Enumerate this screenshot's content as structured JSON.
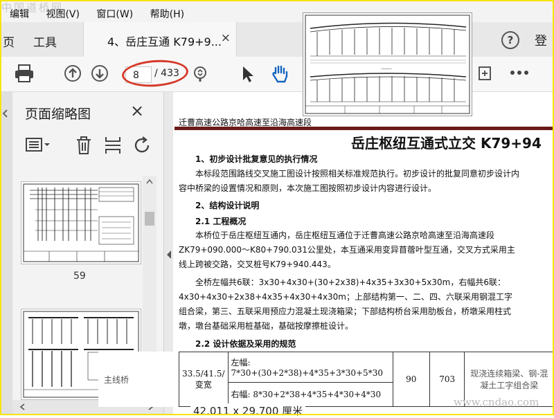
{
  "watermark_top": "中国道桥网",
  "menu": [
    "编辑",
    "视图(V)",
    "窗口(W)",
    "帮助(H)"
  ],
  "tabs": {
    "left_partial": "页",
    "tools": "工具",
    "document": "4、岳庄互通 K79+9...",
    "close": "×",
    "login_partial": "登"
  },
  "toolbar": {
    "page_current": "8",
    "page_total": "/ 433"
  },
  "sidebar": {
    "title": "页面缩略图",
    "close": "×",
    "thumb_page": "59"
  },
  "document": {
    "header": "迁曹高速公路京哈高速至沿海高速段",
    "title": "岳庄枢纽互通式立交 K79+94",
    "sec1": "1、初步设计批复意见的执行情况",
    "p1": "本标段范围路线交叉施工图设计按照相关标准规范执行。初步设计的批复同意初步设计内容中桥梁的设置情况和原则，本次施工图按照初步设计内容进行设计。",
    "sec2": "2、结构设计说明",
    "sec21": "2.1 工程概况",
    "p2": "本桥位于岳庄枢纽互通内，岳庄枢纽互通位于迁曹高速公路京哈高速至沿海高速段ZK79+090.000～K80+790.031公里处，本互通采用变异苜蓿叶型互通，交叉方式采用主线上跨被交路，交叉桩号K79+940.443。",
    "p3": "全桥左幅共6联：3x30+4x30+(30+2x38)+4x35+3x30+5x30m，右幅共6联：",
    "p4": "4x30+4x30+2x38+4x35+4x30+4x30m；上部结构第一、二、四、六联采用钢混工字组合梁，第三、五联采用预应力混凝土现浇箱梁；下部结构桥台采用肋板台，桥墩采用柱式墩，墩台基础采用桩基础，基础按摩擦桩设计。",
    "sec22": "2.2 设计依据及采用的规范",
    "table": {
      "c_width": "33.5/41.5/变宽",
      "left_label": "左幅:",
      "left_span": "7*30+(30+2*38)+4*35+3*30+5*30",
      "right_span": "右幅: 8*30+2*38+4*35+4*30+4*30",
      "col3": "90",
      "col4": "703",
      "col5": "现浇连续箱梁、钢-混凝土工字组合梁"
    },
    "main_bridge": "主线桥",
    "page_size": "42.011 x 29.700 厘米"
  },
  "watermark_bottom": "www.cndao.com",
  "colors": {
    "accent_red": "#d63a2a",
    "header_rule": "#6a1a1a",
    "hand_blue": "#1565c0",
    "frame_yellow": "#f5e400"
  }
}
